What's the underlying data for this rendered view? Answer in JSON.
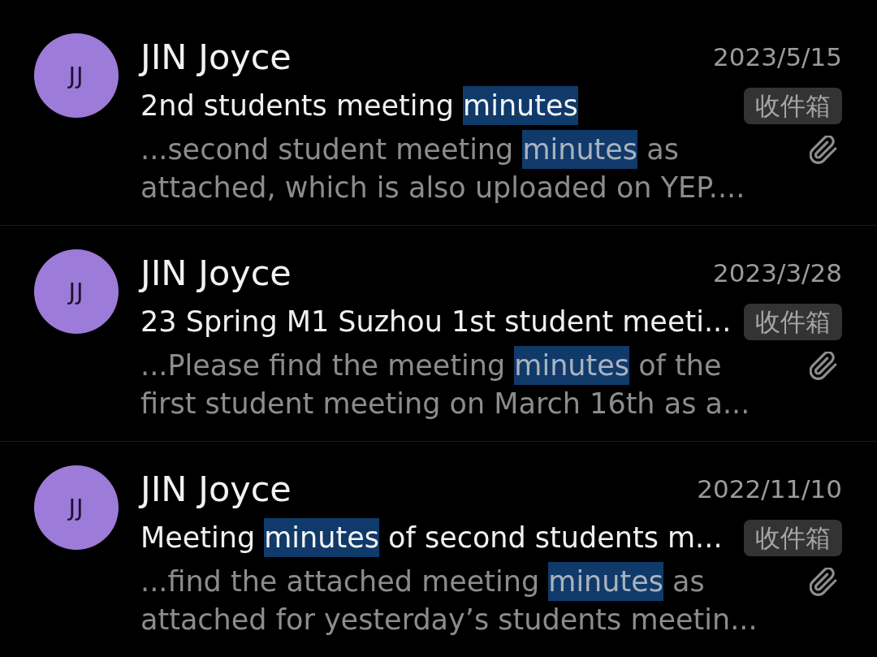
{
  "messages": [
    {
      "avatar_initials": "JJ",
      "sender": "JIN Joyce",
      "date": "2023/5/15",
      "subject": [
        {
          "text": "2nd students meeting ",
          "highlighted": false
        },
        {
          "text": "minutes",
          "highlighted": true
        }
      ],
      "folder": "收件箱",
      "has_attachment": true,
      "preview": [
        {
          "text": "...second student meeting ",
          "highlighted": false
        },
        {
          "text": "minutes",
          "highlighted": true
        },
        {
          "text": " as attached, which is also uploaded on YEP....",
          "highlighted": false
        }
      ]
    },
    {
      "avatar_initials": "JJ",
      "sender": "JIN Joyce",
      "date": "2023/3/28",
      "subject": [
        {
          "text": "23 Spring M1 Suzhou 1st student meeti...",
          "highlighted": false
        }
      ],
      "folder": "收件箱",
      "has_attachment": true,
      "preview": [
        {
          "text": "...Please find the meeting ",
          "highlighted": false
        },
        {
          "text": "minutes",
          "highlighted": true
        },
        {
          "text": " of the first student meeting on March 16th as a...",
          "highlighted": false
        }
      ]
    },
    {
      "avatar_initials": "JJ",
      "sender": "JIN Joyce",
      "date": "2022/11/10",
      "subject": [
        {
          "text": "Meeting ",
          "highlighted": false
        },
        {
          "text": "minutes",
          "highlighted": true
        },
        {
          "text": " of second students m...",
          "highlighted": false
        }
      ],
      "folder": "收件箱",
      "has_attachment": true,
      "preview": [
        {
          "text": "...find the attached meeting ",
          "highlighted": false
        },
        {
          "text": "minutes",
          "highlighted": true
        },
        {
          "text": " as attached for yesterday’s students meetin...",
          "highlighted": false
        }
      ]
    }
  ]
}
